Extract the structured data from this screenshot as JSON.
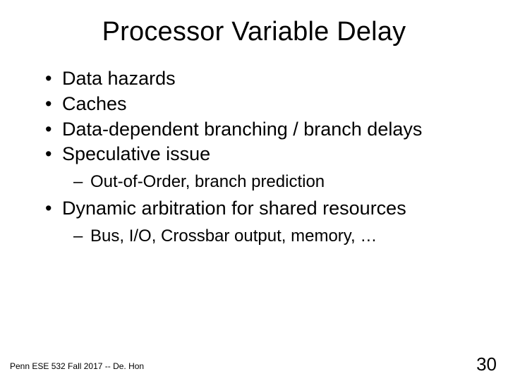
{
  "title": "Processor Variable Delay",
  "bullets": {
    "b0": "Data hazards",
    "b1": "Caches",
    "b2": "Data-dependent branching / branch delays",
    "b3": "Speculative issue",
    "b3_sub0": "Out-of-Order, branch prediction",
    "b4": "Dynamic arbitration for shared resources",
    "b4_sub0": "Bus, I/O, Crossbar output, memory, …"
  },
  "footer": {
    "left": "Penn ESE 532 Fall 2017 -- De. Hon",
    "page": "30"
  }
}
